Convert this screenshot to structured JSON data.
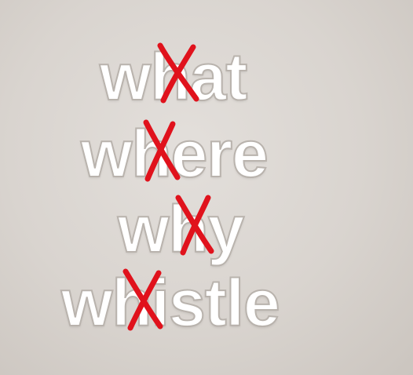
{
  "words": [
    {
      "prefix": "w",
      "silent": "h",
      "rest": "at"
    },
    {
      "prefix": "w",
      "silent": "h",
      "rest": "ere"
    },
    {
      "prefix": "w",
      "silent": "h",
      "rest": "y"
    },
    {
      "prefix": "w",
      "silent": "h",
      "rest": "istle"
    }
  ],
  "colors": {
    "letters": "#ffffff",
    "letter_outline": "#b9b3ad",
    "cross_mark": "#e0121c",
    "background": "#d9d4cf"
  },
  "icons": {
    "cross_mark": "red-x-mark-icon"
  }
}
